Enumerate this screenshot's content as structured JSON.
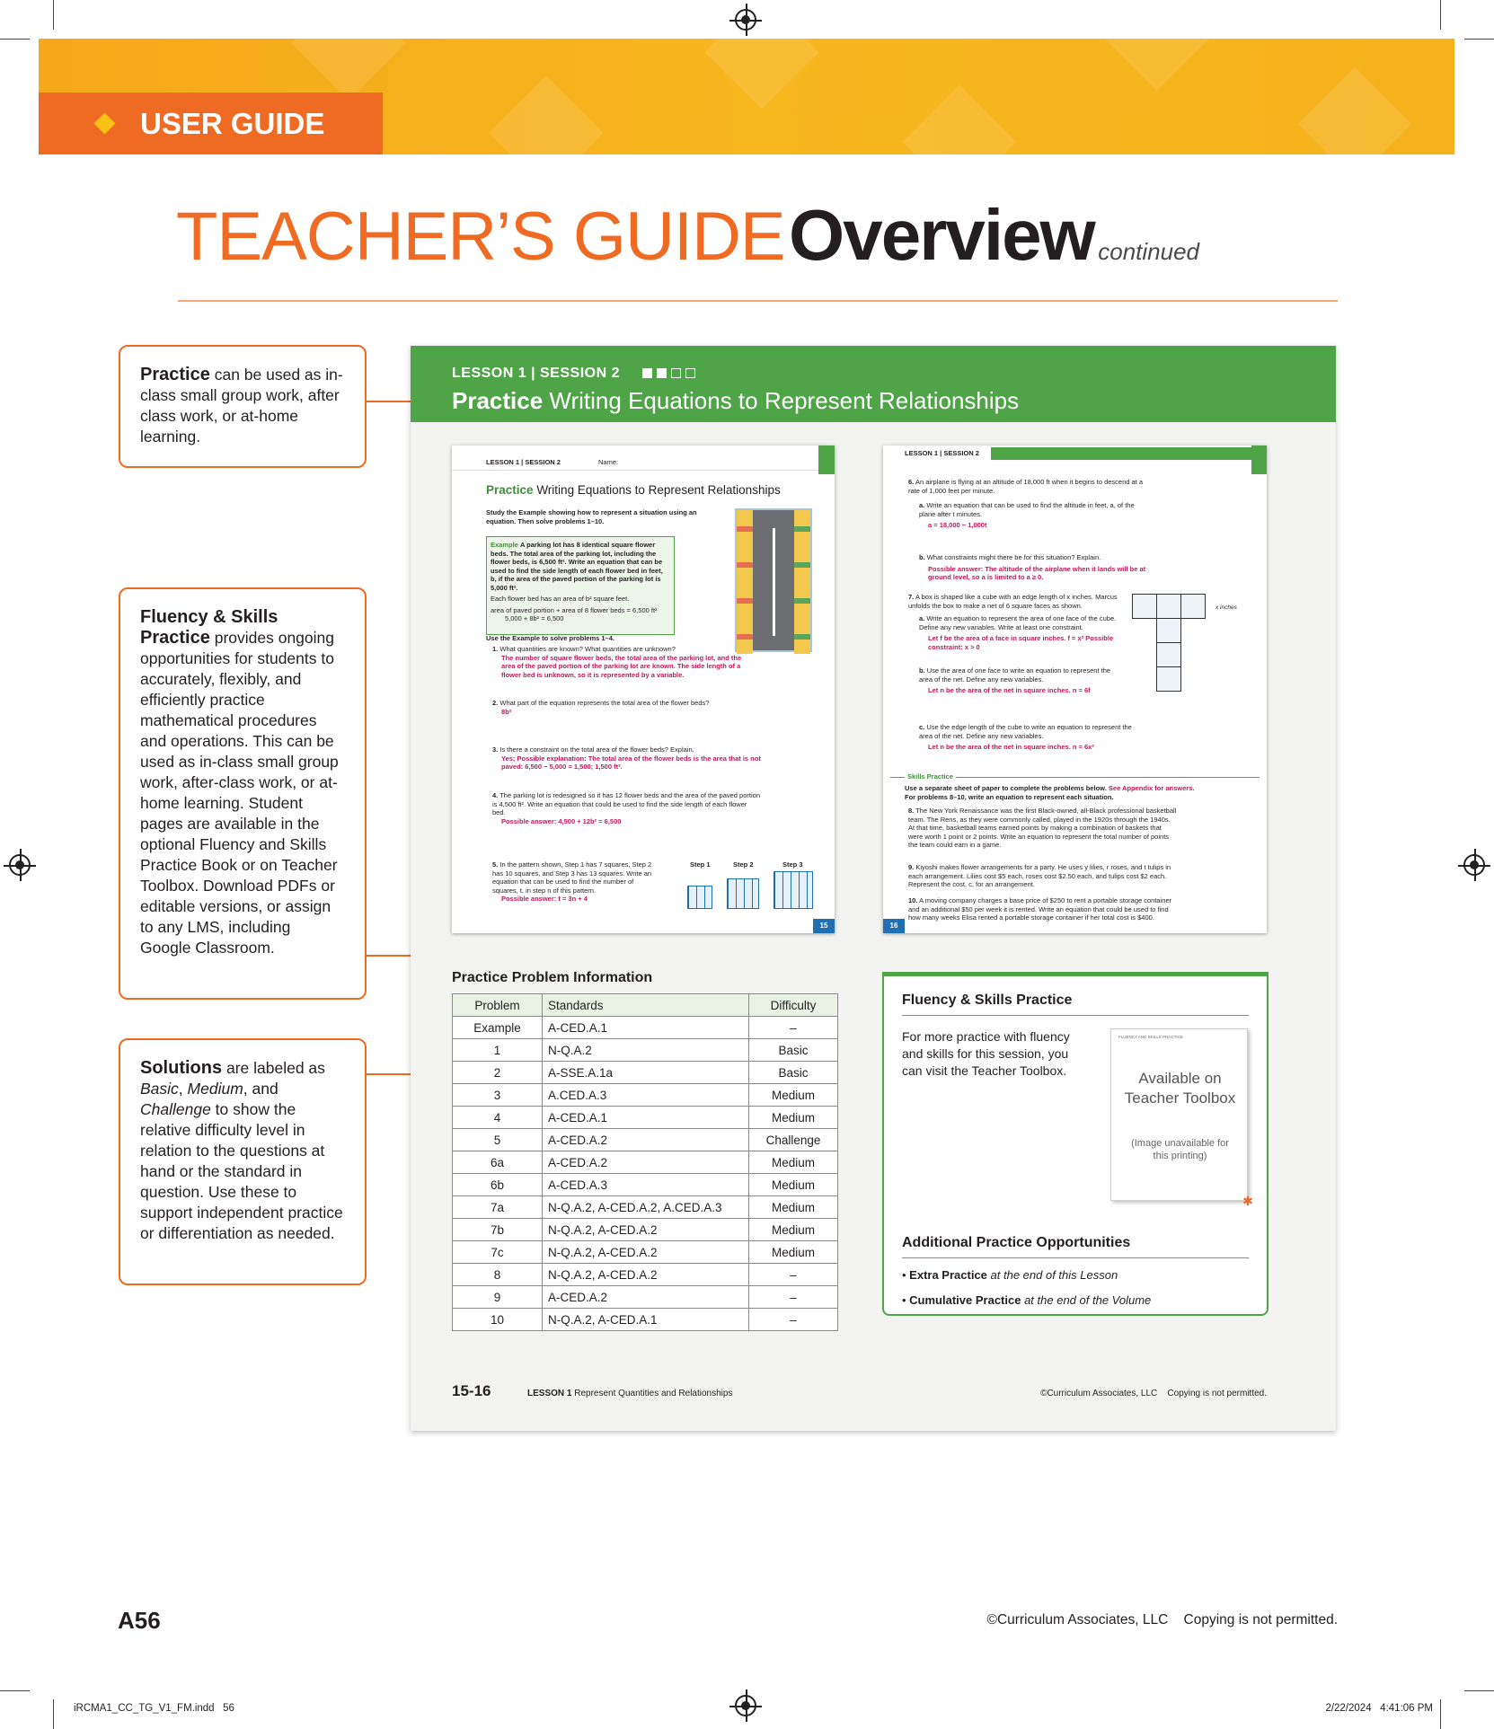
{
  "banner": {
    "label": "USER GUIDE"
  },
  "title": {
    "main_light": "TEACHER’S GUIDE",
    "main_bold": "Overview",
    "suffix": "continued"
  },
  "callouts": {
    "practice": {
      "bold": "Practice",
      "text": " can be used as in-class small group work, after class work, or at-home learning."
    },
    "fluency": {
      "bold": "Fluency & Skills Practice",
      "text": " provides ongoing opportunities for students to accurately, flexibly, and efficiently practice mathematical procedures and operations. This can be used as in-class small group work, after-class work, or at-home learning. Student pages are available in the optional Fluency and Skills Practice Book or on Teacher Toolbox. Download PDFs or editable versions, or assign to any LMS, including Google Classroom."
    },
    "solutions": {
      "bold": "Solutions",
      "text_parts": [
        " are labeled as ",
        "Basic",
        ", ",
        "Medium",
        ", and ",
        "Challenge",
        " to show the relative difficulty level in relation to the questions at hand or the standard in question. Use these to support independent practice or differentiation as needed."
      ]
    }
  },
  "spread": {
    "lesson_label": "LESSON 1 | SESSION 2",
    "title_bold": "Practice",
    "title_rest": "Writing Equations to Represent Relationships",
    "page_left": {
      "header": "LESSON 1  |  SESSION 2",
      "name_label": "Name:",
      "title_bold": "Practice",
      "title_rest": "Writing Equations to Represent Relationships",
      "intro": "Study the Example showing how to represent a situation using an equation. Then solve problems 1–10.",
      "example_label": "Example",
      "example_text": "A parking lot has 8 identical square flower beds. The total area of the parking lot, including the flower beds, is 6,500 ft². Write an equation that can be used to find the side length of each flower bed in feet, b, if the area of the paved portion of the parking lot is 5,000 ft².",
      "example_line1": "Each flower bed has an area of b² square feet.",
      "example_line2": "area of paved portion + area of 8 flower beds = 6,500 ft²",
      "example_line3": "5,000 + 8b² = 6,500",
      "use_example": "Use the Example to solve problems 1–4.",
      "problems": [
        {
          "n": "1.",
          "q": "What quantities are known? What quantities are unknown?",
          "a": "The number of square flower beds, the total area of the parking lot, and the area of the paved portion of the parking lot are known. The side length of a flower bed is unknown, so it is represented by a variable."
        },
        {
          "n": "2.",
          "q": "What part of the equation represents the total area of the flower beds?",
          "a": "8b²"
        },
        {
          "n": "3.",
          "q": "Is there a constraint on the total area of the flower beds? Explain.",
          "a": "Yes; Possible explanation: The total area of the flower beds is the area that is not paved: 6,500 − 5,000 = 1,500; 1,500 ft²."
        },
        {
          "n": "4.",
          "q": "The parking lot is redesigned so it has 12 flower beds and the area of the paved portion is 4,500 ft². Write an equation that could be used to find the side length of each flower bed.",
          "a": "Possible answer: 4,500 + 12b² = 6,500"
        },
        {
          "n": "5.",
          "q": "In the pattern shown, Step 1 has 7 squares, Step 2 has 10 squares, and Step 3 has 13 squares. Write an equation that can be used to find the number of squares, t, in step n of this pattern.",
          "a": "Possible answer: t = 3n + 4"
        }
      ],
      "steps": [
        "Step 1",
        "Step 2",
        "Step 3"
      ],
      "page_num": "15"
    },
    "page_right": {
      "header": "LESSON 1  |  SESSION 2",
      "problems": [
        {
          "n": "6.",
          "q": "An airplane is flying at an altitude of 18,000 ft when it begins to descend at a rate of 1,000 feet per minute."
        },
        {
          "n": "a.",
          "q": "Write an equation that can be used to find the altitude in feet, a, of the plane after t minutes.",
          "a": "a = 18,000 − 1,000t"
        },
        {
          "n": "b.",
          "q": "What constraints might there be for this situation? Explain.",
          "a": "Possible answer: The altitude of the airplane when it lands will be at ground level, so a is limited to a ≥ 0."
        },
        {
          "n": "7.",
          "q": "A box is shaped like a cube with an edge length of x inches. Marcus unfolds the box to make a net of 6 square faces as shown."
        },
        {
          "n": "a.",
          "q": "Write an equation to represent the area of one face of the cube. Define any new variables. Write at least one constraint.",
          "a": "Let f be the area of a face in square inches. f = x²   Possible constraint: x > 0"
        },
        {
          "n": "b.",
          "q": "Use the area of one face to write an equation to represent the area of the net. Define any new variables.",
          "a": "Let n be the area of the net in square inches. n = 6f"
        },
        {
          "n": "c.",
          "q": "Use the edge length of the cube to write an equation to represent the area of the net. Define any new variables.",
          "a": "Let n be the area of the net in square inches. n = 6x²"
        }
      ],
      "net_label": "x inches",
      "skills_label": "Skills Practice",
      "skills_intro": "Use a separate sheet of paper to complete the problems below.",
      "skills_link": "See Appendix for answers.",
      "skills_intro2": "For problems 8–10, write an equation to represent each situation.",
      "skills": [
        {
          "n": "8.",
          "q": "The New York Renaissance was the first Black-owned, all-Black professional basketball team. The Rens, as they were commonly called, played in the 1920s through the 1940s. At that time, basketball teams earned points by making a combination of baskets that were worth 1 point or 2 points. Write an equation to represent the total number of points the team could earn in a game."
        },
        {
          "n": "9.",
          "q": "Kiyoshi makes flower arrangements for a party. He uses y lilies, r roses, and t tulips in each arrangement. Lilies cost $5 each, roses cost $2.50 each, and tulips cost $2 each. Represent the cost, c, for an arrangement."
        },
        {
          "n": "10.",
          "q": "A moving company charges a base price of $250 to rent a portable storage container and an additional $50 per week it is rented. Write an equation that could be used to find how many weeks Elisa rented a portable storage container if her total cost is $400."
        }
      ],
      "page_num": "16"
    },
    "ppi": {
      "title": "Practice Problem Information",
      "headers": [
        "Problem",
        "Standards",
        "Difficulty"
      ],
      "rows": [
        [
          "Example",
          "A-CED.A.1",
          "–"
        ],
        [
          "1",
          "N-Q.A.2",
          "Basic"
        ],
        [
          "2",
          "A-SSE.A.1a",
          "Basic"
        ],
        [
          "3",
          "A.CED.A.3",
          "Medium"
        ],
        [
          "4",
          "A-CED.A.1",
          "Medium"
        ],
        [
          "5",
          "A-CED.A.2",
          "Challenge"
        ],
        [
          "6a",
          "A-CED.A.2",
          "Medium"
        ],
        [
          "6b",
          "A-CED.A.3",
          "Medium"
        ],
        [
          "7a",
          "N-Q.A.2, A-CED.A.2, A.CED.A.3",
          "Medium"
        ],
        [
          "7b",
          "N-Q.A.2, A-CED.A.2",
          "Medium"
        ],
        [
          "7c",
          "N-Q.A.2, A-CED.A.2",
          "Medium"
        ],
        [
          "8",
          "N-Q.A.2, A-CED.A.2",
          "–"
        ],
        [
          "9",
          "A-CED.A.2",
          "–"
        ],
        [
          "10",
          "N-Q.A.2, A-CED.A.1",
          "–"
        ]
      ]
    },
    "fsp": {
      "title": "Fluency & Skills Practice",
      "text": "For more practice with fluency and skills for this session, you can visit the Teacher Toolbox.",
      "thumb_main": "Available on Teacher Toolbox",
      "thumb_sub": "(Image unavailable for this printing)",
      "thumb_header": "FLUENCY AND SKILLS PRACTICE",
      "additional_title": "Additional Practice Opportunities",
      "items": [
        {
          "bold": "Extra Practice",
          "italic": "at the end of this Lesson"
        },
        {
          "bold": "Cumulative Practice",
          "italic": "at the end of the Volume"
        }
      ]
    },
    "footer": {
      "pages": "15-16",
      "lesson_bold": "LESSON 1",
      "lesson_text": "Represent Quantities and Relationships",
      "copyright": "©Curriculum Associates, LLC    Copying is not permitted."
    }
  },
  "footer": {
    "page": "A56",
    "copyright": "©Curriculum Associates, LLC    Copying is not permitted."
  },
  "slug": {
    "file": "iRCMA1_CC_TG_V1_FM.indd   56",
    "date": "2/22/2024   4:41:06 PM"
  }
}
